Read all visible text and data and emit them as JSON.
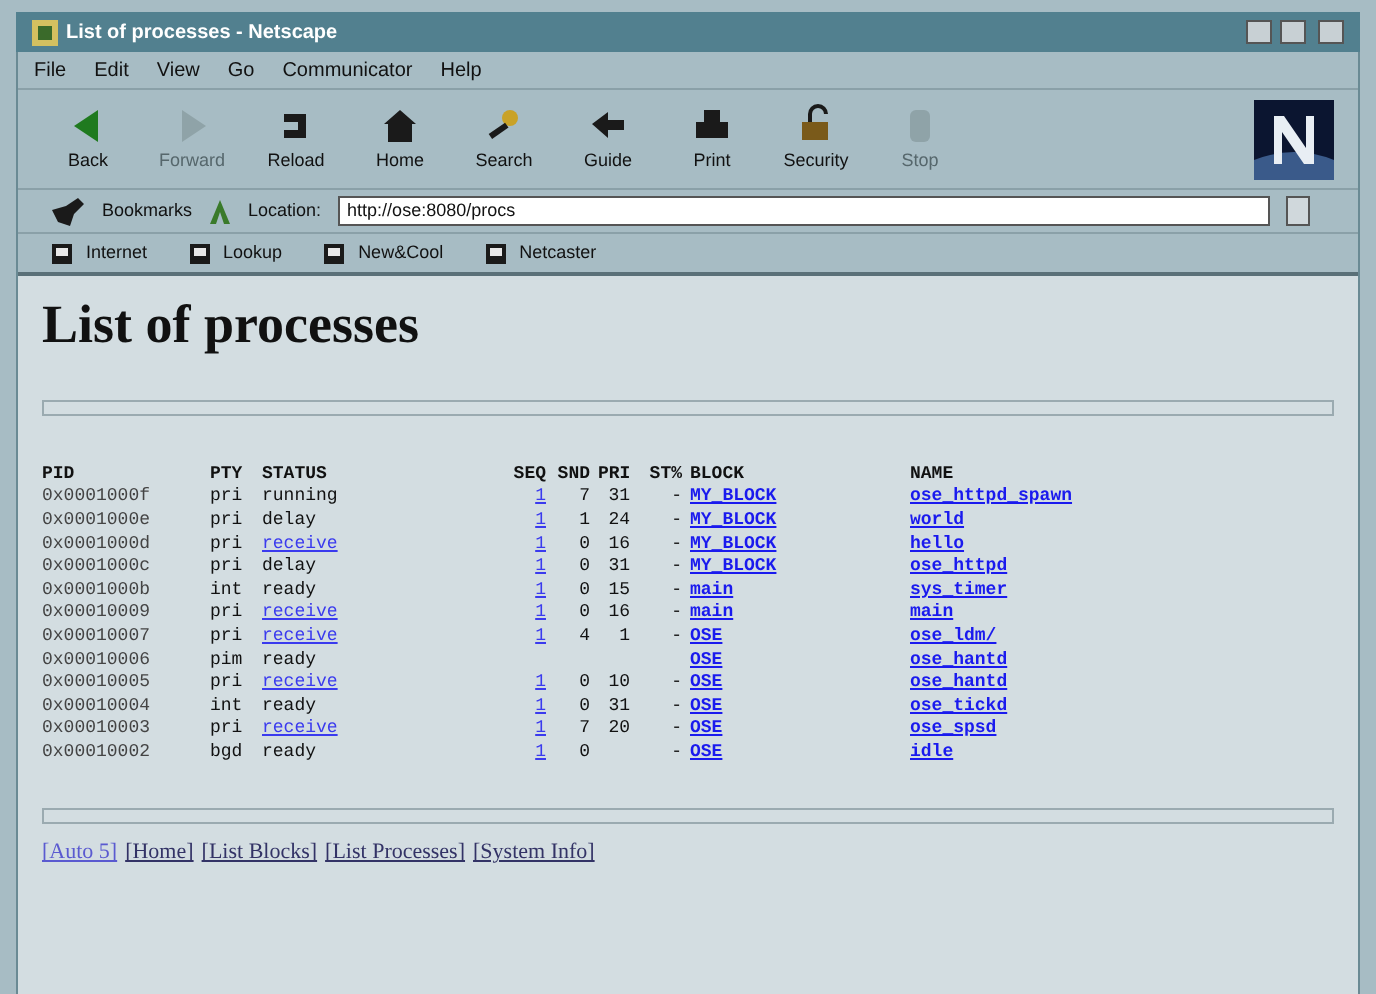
{
  "window": {
    "title": "List of processes - Netscape"
  },
  "menu": [
    "File",
    "Edit",
    "View",
    "Go",
    "Communicator",
    "Help"
  ],
  "toolbar": [
    {
      "label": "Back",
      "kind": "back",
      "disabled": false
    },
    {
      "label": "Forward",
      "kind": "forward",
      "disabled": true
    },
    {
      "label": "Reload",
      "kind": "reload",
      "disabled": false
    },
    {
      "label": "Home",
      "kind": "home",
      "disabled": false
    },
    {
      "label": "Search",
      "kind": "search",
      "disabled": false
    },
    {
      "label": "Guide",
      "kind": "guide",
      "disabled": false
    },
    {
      "label": "Print",
      "kind": "print",
      "disabled": false
    },
    {
      "label": "Security",
      "kind": "security",
      "disabled": false
    },
    {
      "label": "Stop",
      "kind": "stop",
      "disabled": true
    }
  ],
  "location_bar": {
    "bookmarks": "Bookmarks",
    "label": "Location:",
    "value": "http://ose:8080/procs"
  },
  "personal_toolbar": [
    "Internet",
    "Lookup",
    "New&Cool",
    "Netcaster"
  ],
  "page": {
    "heading": "List of processes",
    "table": {
      "columns": [
        "PID",
        "PTY",
        "STATUS",
        "SEQ",
        "SND",
        "PRI",
        "ST%",
        "BLOCK",
        "NAME"
      ],
      "rows": [
        {
          "pid": "0x0001000f",
          "pty": "pri",
          "status": "running",
          "status_link": false,
          "seq": "1",
          "snd": "7",
          "pri": "31",
          "st": "-",
          "block": "MY_BLOCK",
          "name": "ose_httpd_spawn"
        },
        {
          "pid": "0x0001000e",
          "pty": "pri",
          "status": "delay",
          "status_link": false,
          "seq": "1",
          "snd": "1",
          "pri": "24",
          "st": "-",
          "block": "MY_BLOCK",
          "name": "world"
        },
        {
          "pid": "0x0001000d",
          "pty": "pri",
          "status": "receive",
          "status_link": true,
          "seq": "1",
          "snd": "0",
          "pri": "16",
          "st": "-",
          "block": "MY_BLOCK",
          "name": "hello"
        },
        {
          "pid": "0x0001000c",
          "pty": "pri",
          "status": "delay",
          "status_link": false,
          "seq": "1",
          "snd": "0",
          "pri": "31",
          "st": "-",
          "block": "MY_BLOCK",
          "name": "ose_httpd"
        },
        {
          "pid": "0x0001000b",
          "pty": "int",
          "status": "ready",
          "status_link": false,
          "seq": "1",
          "snd": "0",
          "pri": "15",
          "st": "-",
          "block": "main",
          "name": "sys_timer"
        },
        {
          "pid": "0x00010009",
          "pty": "pri",
          "status": "receive",
          "status_link": true,
          "seq": "1",
          "snd": "0",
          "pri": "16",
          "st": "-",
          "block": "main",
          "name": "main"
        },
        {
          "pid": "0x00010007",
          "pty": "pri",
          "status": "receive",
          "status_link": true,
          "seq": "1",
          "snd": "4",
          "pri": "1",
          "st": "-",
          "block": "OSE",
          "name": "ose_ldm/"
        },
        {
          "pid": "0x00010006",
          "pty": "pim",
          "status": "ready",
          "status_link": false,
          "seq": "",
          "snd": "",
          "pri": "",
          "st": "",
          "block": "OSE",
          "name": "ose_hantd"
        },
        {
          "pid": "0x00010005",
          "pty": "pri",
          "status": "receive",
          "status_link": true,
          "seq": "1",
          "snd": "0",
          "pri": "10",
          "st": "-",
          "block": "OSE",
          "name": "ose_hantd"
        },
        {
          "pid": "0x00010004",
          "pty": "int",
          "status": "ready",
          "status_link": false,
          "seq": "1",
          "snd": "0",
          "pri": "31",
          "st": "-",
          "block": "OSE",
          "name": "ose_tickd"
        },
        {
          "pid": "0x00010003",
          "pty": "pri",
          "status": "receive",
          "status_link": true,
          "seq": "1",
          "snd": "7",
          "pri": "20",
          "st": "-",
          "block": "OSE",
          "name": "ose_spsd"
        },
        {
          "pid": "0x00010002",
          "pty": "bgd",
          "status": "ready",
          "status_link": false,
          "seq": "1",
          "snd": "0",
          "pri": "",
          "st": "-",
          "block": "OSE",
          "name": "idle"
        }
      ]
    },
    "footer_links": [
      {
        "label": "[Auto 5]",
        "visited": true
      },
      {
        "label": "[Home]",
        "visited": false
      },
      {
        "label": "[List Blocks]",
        "visited": false
      },
      {
        "label": "[List Processes]",
        "visited": false
      },
      {
        "label": "[System Info]",
        "visited": false
      }
    ]
  }
}
